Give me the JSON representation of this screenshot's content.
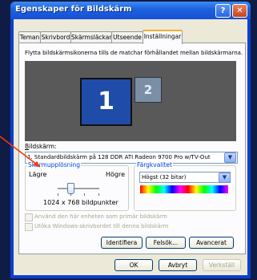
{
  "window": {
    "title": "Egenskaper för Bildskärm"
  },
  "title_buttons": {
    "help": "?",
    "close": "✕"
  },
  "tabs": [
    {
      "label": "Teman"
    },
    {
      "label": "Skrivbord"
    },
    {
      "label": "Skärmsläckare"
    },
    {
      "label": "Utseende"
    },
    {
      "label": "Inställningar"
    }
  ],
  "settings": {
    "description": "Flytta bildskärmsikonerna tills de matchar förhållandet mellan bildskärmarna.",
    "monitors": [
      {
        "number": "1"
      },
      {
        "number": "2"
      }
    ],
    "display_label": "Bildskärm:",
    "display_value": "1. Standardbildskärm på 128 DDR ATI Radeon 9700 Pro w/TV-Out",
    "resolution": {
      "legend": "Skärmupplösning",
      "low_label": "Lägre",
      "high_label": "Högre",
      "value_text": "1024 x 768 bildpunkter"
    },
    "color_quality": {
      "legend": "Färgkvalitet",
      "value": "Högst (32 bitar)"
    },
    "checkboxes": [
      {
        "label": "Använd den här enheten som primär bildskärm"
      },
      {
        "label": "Utöka Windows-skrivbordet till denna bildskärm"
      }
    ],
    "buttons": {
      "identify": "Identifiera",
      "troubleshoot": "Felsök...",
      "advanced": "Avancerat"
    }
  },
  "footer": {
    "ok": "OK",
    "cancel": "Avbryt",
    "apply": "Verkställ"
  },
  "colors": {
    "titlebar": "#1450d4",
    "arrow": "#ff3300",
    "monitor_selected": "#1e4ca8"
  }
}
